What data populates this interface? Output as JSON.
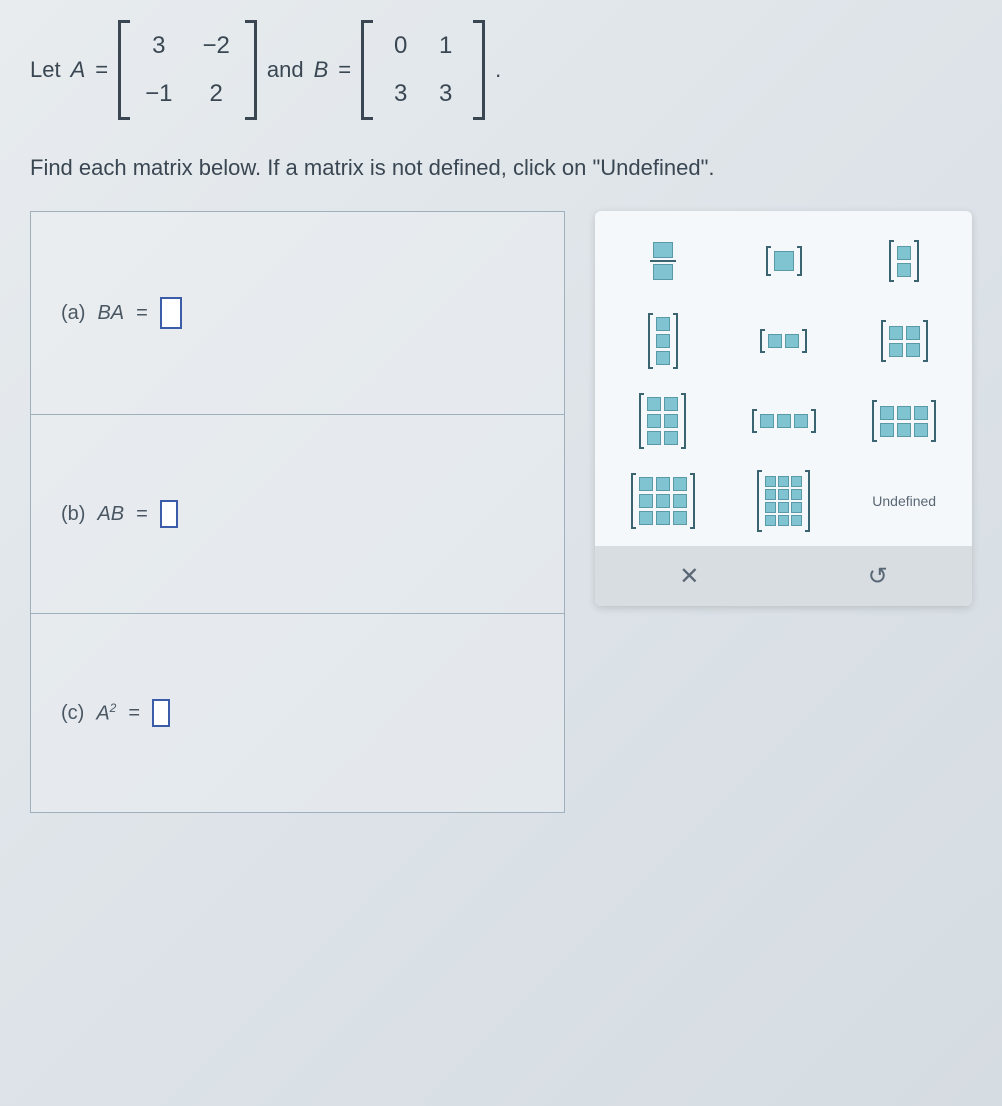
{
  "problem": {
    "let": "Let",
    "A_label": "A",
    "equals": "=",
    "and": "and",
    "B_label": "B",
    "period": ".",
    "matrix_A": [
      "3",
      "−2",
      "−1",
      "2"
    ],
    "matrix_B": [
      "0",
      "1",
      "3",
      "3"
    ],
    "instruction": "Find each matrix below. If a matrix is not defined, click on \"Undefined\"."
  },
  "parts": {
    "a": {
      "label": "(a)",
      "expr": "BA",
      "eq": "="
    },
    "b": {
      "label": "(b)",
      "expr": "AB",
      "eq": "="
    },
    "c": {
      "label": "(c)",
      "expr_base": "A",
      "expr_sup": "2",
      "eq": "="
    }
  },
  "palette": {
    "undefined": "Undefined",
    "close": "✕",
    "reset": "↺"
  }
}
